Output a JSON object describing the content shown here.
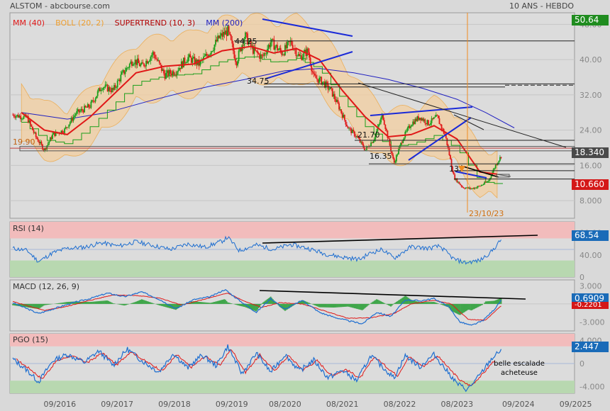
{
  "header": {
    "source": "ALSTOM - abcbourse.com",
    "period": "10 ANS - HEBDO"
  },
  "colors": {
    "price_up": "#1a9e1a",
    "price_down": "#e01818",
    "mm40": "#e01818",
    "boll": "#f0a030",
    "boll_fill": "#f3cfa0",
    "supertrend": "#b30000",
    "mm200": "#2020c0",
    "rsi": "#1e6ed0",
    "macd": "#1e6ed0",
    "signal": "#e01818",
    "zone_high": "#f2bcbc",
    "zone_low": "#b8d8b0",
    "tag_green": "#1f8c1f",
    "tag_red": "#d41818",
    "tag_blue": "#1a6bb8",
    "orange_line": "#f08c20"
  },
  "chart_data": [
    {
      "type": "candlestick",
      "legend": [
        {
          "label": "MM (40)",
          "color": "#e01818"
        },
        {
          "label": "BOLL (20, 2)",
          "color": "#f0a030"
        },
        {
          "label": "SUPERTREND (10, 3)",
          "color": "#b30000"
        },
        {
          "label": "MM (200)",
          "color": "#2020c0"
        }
      ],
      "y_ticks": [
        "48.00",
        "40.00",
        "32.00",
        "24.00",
        "16.00",
        "8.000"
      ],
      "ylim": [
        4,
        50.64
      ],
      "x_range": [
        2015.8,
        2025.65
      ],
      "x_ticks": [
        "09/2016",
        "09/2017",
        "09/2018",
        "09/2019",
        "08/2020",
        "08/2021",
        "08/2022",
        "08/2023",
        "09/2024",
        "09/2025"
      ],
      "x_tick_pos": [
        2016.67,
        2017.67,
        2018.67,
        2019.67,
        2020.6,
        2021.6,
        2022.6,
        2023.6,
        2024.67,
        2025.67
      ],
      "price_path": [
        [
          2015.85,
          27.5
        ],
        [
          2016.1,
          26.8
        ],
        [
          2016.25,
          22.5
        ],
        [
          2016.4,
          19.5
        ],
        [
          2016.55,
          23.0
        ],
        [
          2016.75,
          24.0
        ],
        [
          2016.95,
          27.8
        ],
        [
          2017.2,
          29.5
        ],
        [
          2017.4,
          34.0
        ],
        [
          2017.6,
          33.0
        ],
        [
          2017.75,
          36.5
        ],
        [
          2017.95,
          40.0
        ],
        [
          2018.1,
          38.5
        ],
        [
          2018.3,
          41.5
        ],
        [
          2018.5,
          36.5
        ],
        [
          2018.7,
          37.5
        ],
        [
          2018.9,
          40.5
        ],
        [
          2019.1,
          39.0
        ],
        [
          2019.3,
          42.0
        ],
        [
          2019.45,
          45.0
        ],
        [
          2019.6,
          46.5
        ],
        [
          2019.75,
          39.5
        ],
        [
          2019.9,
          45.5
        ],
        [
          2020.05,
          42.0
        ],
        [
          2020.2,
          40.5
        ],
        [
          2020.35,
          44.0
        ],
        [
          2020.55,
          41.5
        ],
        [
          2020.7,
          44.0
        ],
        [
          2020.85,
          40.5
        ],
        [
          2021.0,
          42.0
        ],
        [
          2021.1,
          36.0
        ],
        [
          2021.25,
          35.0
        ],
        [
          2021.4,
          33.0
        ],
        [
          2021.55,
          29.0
        ],
        [
          2021.7,
          24.5
        ],
        [
          2021.85,
          22.5
        ],
        [
          2022.0,
          19.5
        ],
        [
          2022.15,
          22.0
        ],
        [
          2022.3,
          27.5
        ],
        [
          2022.5,
          16.5
        ],
        [
          2022.65,
          22.0
        ],
        [
          2022.8,
          25.5
        ],
        [
          2022.95,
          27.0
        ],
        [
          2023.1,
          25.5
        ],
        [
          2023.25,
          27.0
        ],
        [
          2023.4,
          22.5
        ],
        [
          2023.55,
          13.2
        ],
        [
          2023.7,
          11.0
        ],
        [
          2023.85,
          10.7
        ],
        [
          2024.0,
          11.3
        ],
        [
          2024.15,
          12.5
        ],
        [
          2024.27,
          16.0
        ],
        [
          2024.38,
          18.34
        ]
      ],
      "mm40_path": [
        [
          2016.0,
          28.0
        ],
        [
          2016.4,
          24.0
        ],
        [
          2016.8,
          23.0
        ],
        [
          2017.2,
          27.0
        ],
        [
          2017.6,
          32.0
        ],
        [
          2018.0,
          37.0
        ],
        [
          2018.5,
          38.5
        ],
        [
          2019.0,
          39.0
        ],
        [
          2019.5,
          42.0
        ],
        [
          2020.0,
          43.0
        ],
        [
          2020.4,
          41.5
        ],
        [
          2020.8,
          42.5
        ],
        [
          2021.2,
          40.0
        ],
        [
          2021.6,
          33.0
        ],
        [
          2022.0,
          27.0
        ],
        [
          2022.4,
          22.5
        ],
        [
          2022.8,
          23.0
        ],
        [
          2023.2,
          25.0
        ],
        [
          2023.6,
          22.0
        ],
        [
          2024.0,
          14.5
        ],
        [
          2024.3,
          14.0
        ]
      ],
      "mm200_path": [
        [
          2016.0,
          28.0
        ],
        [
          2016.8,
          26.5
        ],
        [
          2017.5,
          28.0
        ],
        [
          2018.2,
          30.5
        ],
        [
          2018.8,
          32.5
        ],
        [
          2019.3,
          34.0
        ],
        [
          2019.9,
          35.5
        ],
        [
          2020.6,
          37.5
        ],
        [
          2021.2,
          38.0
        ],
        [
          2021.8,
          37.0
        ],
        [
          2022.4,
          35.5
        ],
        [
          2023.0,
          33.5
        ],
        [
          2023.6,
          31.0
        ],
        [
          2024.1,
          28.0
        ],
        [
          2024.6,
          24.5
        ]
      ],
      "annotations": {
        "levels": [
          "44.25",
          "34.75",
          "21.70",
          "16.35",
          "13.",
          "19.90"
        ],
        "date_label": "23/10/23",
        "last_price": "18.340",
        "high_tag": "50.64",
        "low_tag": "10.660"
      }
    },
    {
      "type": "line",
      "name": "RSI (14)",
      "y_ticks": [
        "80.00",
        "40.00",
        "0"
      ],
      "ylim": [
        0,
        100
      ],
      "zones": {
        "upper": 70,
        "lower": 30
      },
      "values_path": [
        [
          2015.85,
          52
        ],
        [
          2016.1,
          48
        ],
        [
          2016.3,
          28
        ],
        [
          2016.55,
          44
        ],
        [
          2016.8,
          52
        ],
        [
          2017.1,
          54
        ],
        [
          2017.4,
          62
        ],
        [
          2017.7,
          56
        ],
        [
          2018.0,
          64
        ],
        [
          2018.3,
          57
        ],
        [
          2018.6,
          50
        ],
        [
          2018.9,
          60
        ],
        [
          2019.2,
          54
        ],
        [
          2019.5,
          65
        ],
        [
          2019.6,
          72
        ],
        [
          2019.8,
          48
        ],
        [
          2020.1,
          58
        ],
        [
          2020.4,
          50
        ],
        [
          2020.7,
          59
        ],
        [
          2021.0,
          52
        ],
        [
          2021.3,
          42
        ],
        [
          2021.6,
          36
        ],
        [
          2021.9,
          32
        ],
        [
          2022.1,
          44
        ],
        [
          2022.3,
          50
        ],
        [
          2022.5,
          34
        ],
        [
          2022.8,
          55
        ],
        [
          2023.1,
          52
        ],
        [
          2023.3,
          56
        ],
        [
          2023.55,
          32
        ],
        [
          2023.75,
          26
        ],
        [
          2024.0,
          30
        ],
        [
          2024.2,
          46
        ],
        [
          2024.38,
          68.54
        ]
      ],
      "last_value": "68.54"
    },
    {
      "type": "line",
      "name": "MACD (12, 26, 9)",
      "y_ticks": [
        "3.000",
        "0",
        "-3.000"
      ],
      "ylim": [
        -4.5,
        4.0
      ],
      "last_value": "0.6909",
      "signal_value": "-0.2201",
      "values_path": [
        [
          2015.85,
          0.2
        ],
        [
          2016.3,
          -1.6
        ],
        [
          2016.6,
          -0.7
        ],
        [
          2016.9,
          0.2
        ],
        [
          2017.2,
          0.9
        ],
        [
          2017.5,
          1.8
        ],
        [
          2017.8,
          1.2
        ],
        [
          2018.1,
          2.0
        ],
        [
          2018.4,
          0.8
        ],
        [
          2018.7,
          -0.8
        ],
        [
          2019.0,
          0.7
        ],
        [
          2019.3,
          1.2
        ],
        [
          2019.55,
          2.4
        ],
        [
          2019.8,
          0.6
        ],
        [
          2020.1,
          -1.4
        ],
        [
          2020.35,
          0.9
        ],
        [
          2020.6,
          -0.9
        ],
        [
          2020.9,
          0.6
        ],
        [
          2021.2,
          -1.4
        ],
        [
          2021.45,
          -2.2
        ],
        [
          2021.7,
          -2.8
        ],
        [
          2021.95,
          -3.3
        ],
        [
          2022.2,
          -1.4
        ],
        [
          2022.45,
          -2.1
        ],
        [
          2022.7,
          0.7
        ],
        [
          2022.95,
          0.5
        ],
        [
          2023.2,
          0.9
        ],
        [
          2023.45,
          -0.4
        ],
        [
          2023.65,
          -3.0
        ],
        [
          2023.85,
          -3.6
        ],
        [
          2024.05,
          -2.8
        ],
        [
          2024.25,
          -0.9
        ],
        [
          2024.38,
          0.69
        ]
      ],
      "signal_path": [
        [
          2015.85,
          0.4
        ],
        [
          2016.4,
          -1.1
        ],
        [
          2016.8,
          -0.4
        ],
        [
          2017.2,
          0.6
        ],
        [
          2017.6,
          1.5
        ],
        [
          2018.0,
          1.4
        ],
        [
          2018.4,
          1.0
        ],
        [
          2018.8,
          -0.2
        ],
        [
          2019.2,
          0.8
        ],
        [
          2019.6,
          1.8
        ],
        [
          2019.9,
          0.4
        ],
        [
          2020.2,
          -0.6
        ],
        [
          2020.5,
          0.2
        ],
        [
          2020.9,
          0.0
        ],
        [
          2021.3,
          -1.2
        ],
        [
          2021.7,
          -2.4
        ],
        [
          2022.1,
          -2.3
        ],
        [
          2022.5,
          -1.6
        ],
        [
          2022.8,
          0.0
        ],
        [
          2023.2,
          0.6
        ],
        [
          2023.5,
          0.0
        ],
        [
          2023.8,
          -2.6
        ],
        [
          2024.1,
          -2.7
        ],
        [
          2024.38,
          -0.22
        ]
      ]
    },
    {
      "type": "line",
      "name": "PGO (15)",
      "y_ticks": [
        "4.000",
        "0",
        "-4.000"
      ],
      "ylim": [
        -5.2,
        5.2
      ],
      "zones": {
        "upper": 3,
        "lower": -3
      },
      "annotation": "belle escalade acheteuse",
      "last_value": "2.447",
      "values_path": [
        [
          2015.85,
          0.8
        ],
        [
          2016.1,
          -1.2
        ],
        [
          2016.3,
          -3.2
        ],
        [
          2016.55,
          0.5
        ],
        [
          2016.8,
          1.6
        ],
        [
          2017.1,
          0.2
        ],
        [
          2017.35,
          2.2
        ],
        [
          2017.6,
          -0.3
        ],
        [
          2017.85,
          2.5
        ],
        [
          2018.1,
          0.5
        ],
        [
          2018.4,
          -1.5
        ],
        [
          2018.65,
          1.8
        ],
        [
          2018.9,
          -0.8
        ],
        [
          2019.15,
          1.5
        ],
        [
          2019.4,
          -0.4
        ],
        [
          2019.6,
          3.0
        ],
        [
          2019.85,
          -1.8
        ],
        [
          2020.1,
          1.8
        ],
        [
          2020.35,
          -1.5
        ],
        [
          2020.6,
          1.6
        ],
        [
          2020.85,
          -1.3
        ],
        [
          2021.1,
          0.6
        ],
        [
          2021.35,
          -2.5
        ],
        [
          2021.6,
          -1.2
        ],
        [
          2021.85,
          -3.0
        ],
        [
          2022.1,
          1.4
        ],
        [
          2022.3,
          -0.6
        ],
        [
          2022.5,
          -2.5
        ],
        [
          2022.7,
          1.4
        ],
        [
          2022.95,
          -0.6
        ],
        [
          2023.2,
          1.6
        ],
        [
          2023.4,
          -1.0
        ],
        [
          2023.6,
          -3.5
        ],
        [
          2023.78,
          -4.6
        ],
        [
          2024.0,
          -2.0
        ],
        [
          2024.2,
          0.8
        ],
        [
          2024.38,
          2.447
        ]
      ]
    }
  ]
}
